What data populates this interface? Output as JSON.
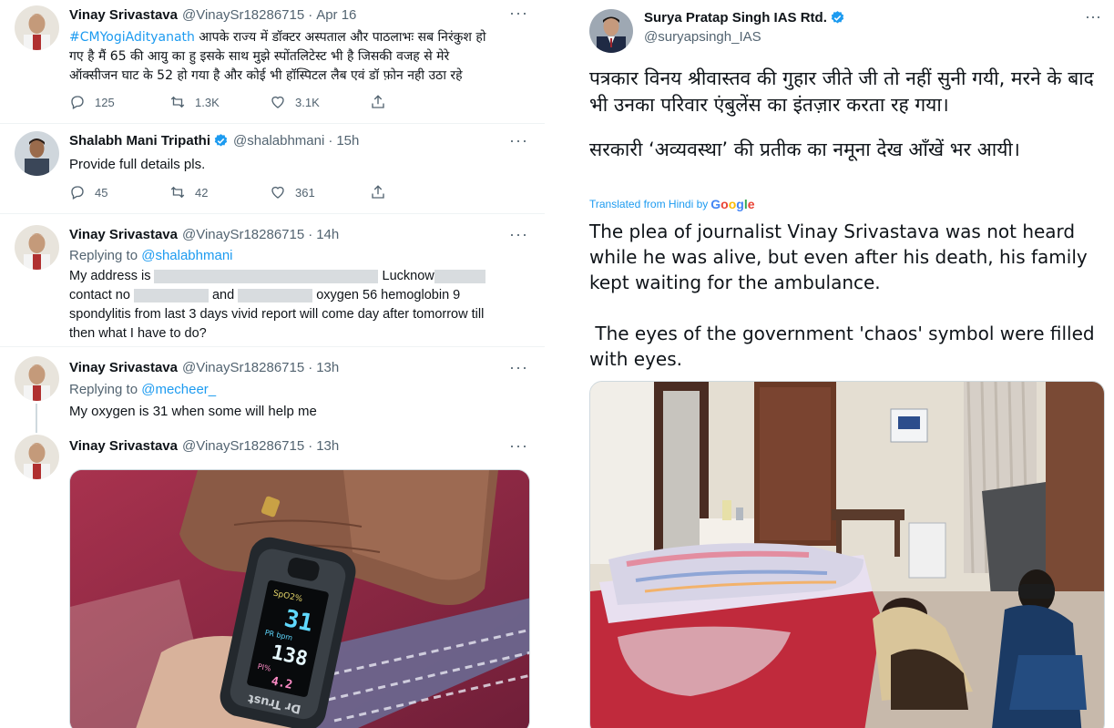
{
  "left": {
    "tweet1": {
      "name": "Vinay Srivastava",
      "handle": "@VinaySr18286715",
      "time": "Apr 16",
      "hashtag": "#CMYogiAdityanath",
      "text_line1": " आपके राज्य में डॉक्टर अस्पताल और पाठलाभः सब निरंकुश हो",
      "text_line2": "गए है मैं 65 की आयु का हु इसके साथ मुझे स्पोंतलिटेस्ट  भी है जिसकी वजह से मेरे",
      "text_line3": "ऑक्सीजन घाट के 52 हो गया है और कोई भी हॉस्पिटल लैब एवं डॉ फ़ोन नही उठा रहे",
      "replies": "125",
      "retweets": "1.3K",
      "likes": "3.1K"
    },
    "tweet2": {
      "name": "Shalabh Mani Tripathi",
      "handle": "@shalabhmani",
      "time": "15h",
      "text": "Provide full details pls.",
      "replies": "45",
      "retweets": "42",
      "likes": "361"
    },
    "tweet3": {
      "name": "Vinay Srivastava",
      "handle": "@VinaySr18286715",
      "time": "14h",
      "replying_prefix": "Replying to ",
      "replying_to": "@shalabhmani",
      "l1_a": "My address is ",
      "l1_b": " Lucknow",
      "l2_a": "contact no ",
      "l2_b": " and ",
      "l2_c": " oxygen 56 hemoglobin 9",
      "l3": "spondylitis  from last 3 days vivid report will come day after tomorrow till",
      "l4": "then what I have to do?"
    },
    "tweet4": {
      "name": "Vinay Srivastava",
      "handle": "@VinaySr18286715",
      "time": "13h",
      "replying_prefix": "Replying to ",
      "replying_to": "@mecheer_",
      "text": "My oxygen is 31 when some will help me"
    },
    "tweet5": {
      "name": "Vinay Srivastava",
      "handle": "@VinaySr18286715",
      "time": "13h",
      "oximeter": {
        "spo2_label": "SpO2%",
        "spo2": "31",
        "pr_label": "PR bpm",
        "pr": "138",
        "pi_label": "PI%",
        "pi": "4.2",
        "brand": "Dr Trust"
      }
    }
  },
  "right": {
    "name": "Surya Pratap Singh IAS Rtd.",
    "handle": "@suryapsingh_IAS",
    "hindi_p1": "पत्रकार विनय श्रीवास्तव की गुहार जीते जी तो नहीं सुनी गयी, मरने के बाद भी उनका परिवार एंबुलेंस का इंतज़ार करता रह गया।",
    "hindi_p2": "सरकारी ‘अव्यवस्था’ की प्रतीक का नमूना देख आँखें भर आयी।",
    "translated_prefix": "Translated from Hindi by ",
    "google": "Google",
    "eng_p1": "The plea of journalist Vinay Srivastava was not heard while he was alive, but even after his death, his family kept waiting for the ambulance.",
    "eng_p2": " The eyes of the government 'chaos' symbol were filled with eyes."
  },
  "colors": {
    "link": "#1d9bf0",
    "secondary_text": "#536471",
    "primary_text": "#0f1419",
    "verified": "#1d9bf0"
  },
  "icons": [
    "reply-icon",
    "retweet-icon",
    "like-icon",
    "share-icon",
    "verified-icon",
    "more-icon"
  ]
}
